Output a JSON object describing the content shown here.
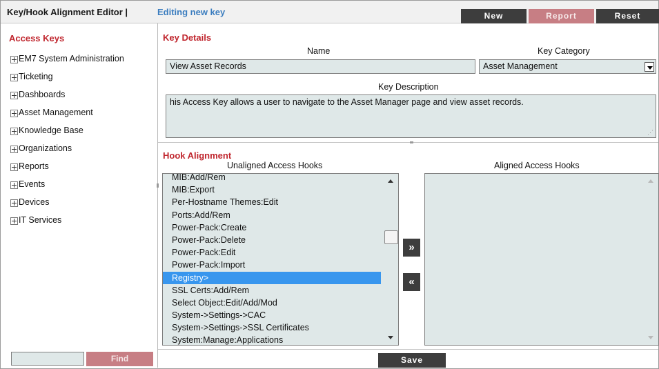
{
  "header": {
    "title": "Key/Hook Alignment Editor |",
    "subtitle": "Editing new key",
    "buttons": {
      "new": "New",
      "report": "Report",
      "reset": "Reset"
    }
  },
  "sidebar": {
    "title": "Access Keys",
    "items": [
      {
        "label": "EM7 System Administration"
      },
      {
        "label": "Ticketing"
      },
      {
        "label": "Dashboards"
      },
      {
        "label": "Asset Management"
      },
      {
        "label": "Knowledge Base"
      },
      {
        "label": "Organizations"
      },
      {
        "label": "Reports"
      },
      {
        "label": "Events"
      },
      {
        "label": "Devices"
      },
      {
        "label": "IT Services"
      }
    ],
    "find": {
      "value": "",
      "button_label": "Find"
    }
  },
  "key_details": {
    "section_title": "Key Details",
    "name_label": "Name",
    "name_value": "View Asset Records",
    "category_label": "Key Category",
    "category_value": "Asset Management",
    "description_label": "Key Description",
    "description_value": "his Access Key allows a user to navigate to the Asset Manager page and view asset records."
  },
  "hook_alignment": {
    "section_title": "Hook Alignment",
    "unaligned_label": "Unaligned Access Hooks",
    "aligned_label": "Aligned Access Hooks",
    "unaligned_items": [
      {
        "label": "MIB:Add/Rem",
        "selected": false
      },
      {
        "label": "MIB:Export",
        "selected": false
      },
      {
        "label": "Per-Hostname Themes:Edit",
        "selected": false
      },
      {
        "label": "Ports:Add/Rem",
        "selected": false
      },
      {
        "label": "Power-Pack:Create",
        "selected": false
      },
      {
        "label": "Power-Pack:Delete",
        "selected": false
      },
      {
        "label": "Power-Pack:Edit",
        "selected": false
      },
      {
        "label": "Power-Pack:Import",
        "selected": false
      },
      {
        "label": "Registry>",
        "selected": true
      },
      {
        "label": "SSL Certs:Add/Rem",
        "selected": false
      },
      {
        "label": "Select Object:Edit/Add/Mod",
        "selected": false
      },
      {
        "label": "System->Settings->CAC",
        "selected": false
      },
      {
        "label": "System->Settings->SSL Certificates",
        "selected": false
      },
      {
        "label": "System:Manage:Applications",
        "selected": false
      }
    ],
    "aligned_items": [],
    "add_button": "»",
    "remove_button": "«"
  },
  "footer": {
    "save_label": "Save"
  }
}
